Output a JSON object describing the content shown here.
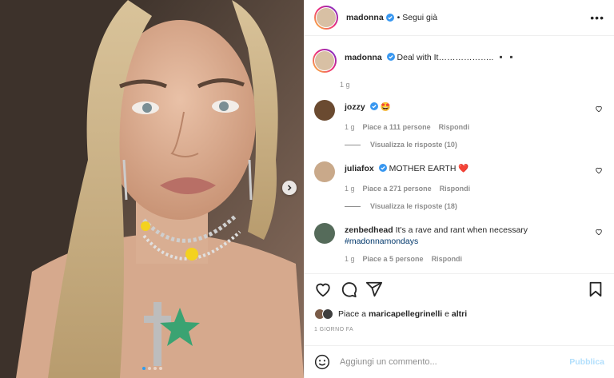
{
  "post": {
    "author": "madonna",
    "follow_label": "• Segui già",
    "more_icon": "more-horizontal-icon",
    "caption_text": "Deal with It……………….. ▪️▪️",
    "caption_time": "1 g"
  },
  "comments": [
    {
      "user": "jozzy",
      "verified": true,
      "text": "",
      "emoji": "🤩",
      "time": "1 g",
      "likes": "Piace a 111 persone",
      "reply": "Rispondi",
      "view_replies": "Visualizza le risposte (10)"
    },
    {
      "user": "juliafox",
      "verified": true,
      "text": "MOTHER EARTH",
      "emoji": "❤️",
      "time": "1 g",
      "likes": "Piace a 271 persone",
      "reply": "Rispondi",
      "view_replies": "Visualizza le risposte (18)"
    },
    {
      "user": "zenbedhead",
      "verified": false,
      "text": "It's a rave and rant when necessary",
      "hashtag": "#madonnamondays",
      "time": "1 g",
      "likes": "Piace a 5 persone",
      "reply": "Rispondi"
    }
  ],
  "likes_summary": {
    "prefix": "Piace a",
    "user": "maricapellegrinelli",
    "middle": "e",
    "others": "altri"
  },
  "time_ago": "1 GIORNO FA",
  "composer": {
    "placeholder": "Aggiungi un commento...",
    "publish": "Pubblica"
  },
  "colors": {
    "verified": "#3897f0",
    "link": "#00376b",
    "publish_disabled": "#b2dffc"
  }
}
